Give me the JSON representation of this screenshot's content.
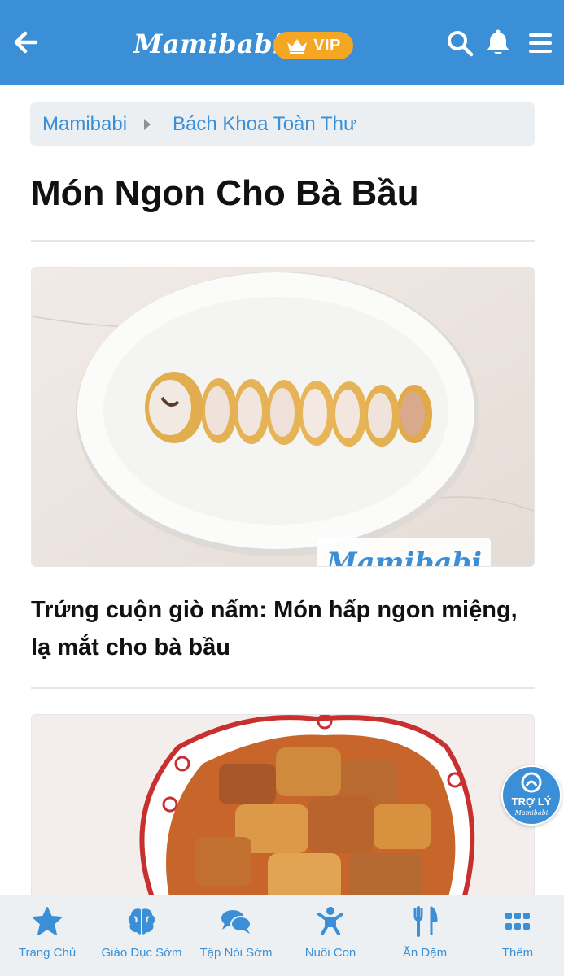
{
  "header": {
    "logo_text": "Mamibabi",
    "vip_label": "VIP",
    "icons": [
      "back-arrow-icon",
      "crown-icon",
      "search-icon",
      "bell-icon",
      "hamburger-menu-icon"
    ],
    "background_color": "#3a8fd6",
    "vip_color": "#f5a623"
  },
  "breadcrumb": {
    "items": [
      {
        "label": "Mamibabi"
      },
      {
        "label": "Bách Khoa Toàn Thư"
      }
    ]
  },
  "page": {
    "title": "Món Ngon Cho Bà Bầu"
  },
  "articles": [
    {
      "title": "Trứng cuộn giò nấm: Món hấp ngon miệng, lạ mắt cho bà bầu",
      "image_watermark": "Mamibabi"
    },
    {
      "title": ""
    }
  ],
  "assistant": {
    "label": "TRỢ LÝ",
    "sub": "Mamibabi"
  },
  "bottom_nav": {
    "items": [
      {
        "label": "Trang Chủ",
        "icon": "star-icon"
      },
      {
        "label": "Giáo Dục Sớm",
        "icon": "brain-icon"
      },
      {
        "label": "Tập Nói Sớm",
        "icon": "chat-bubbles-icon"
      },
      {
        "label": "Nuôi Con",
        "icon": "baby-icon"
      },
      {
        "label": "Ăn Dặm",
        "icon": "fork-knife-icon"
      },
      {
        "label": "Thêm",
        "icon": "grid-icon"
      }
    ]
  }
}
